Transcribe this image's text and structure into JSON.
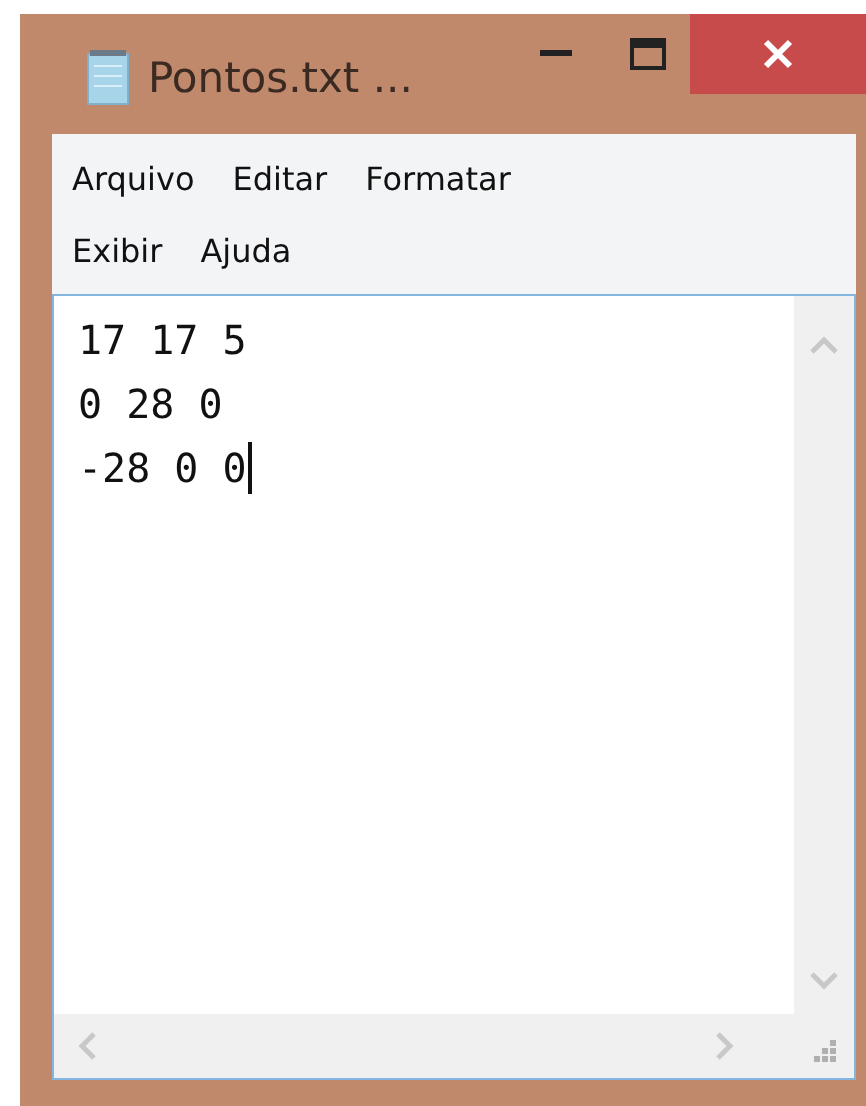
{
  "window": {
    "title": "Pontos.txt ..."
  },
  "menu_rows": [
    [
      "Arquivo",
      "Editar",
      "Formatar"
    ],
    [
      "Exibir",
      "Ajuda"
    ]
  ],
  "editor": {
    "lines": [
      "17 17 5",
      "0 28 0",
      "-28 0 0"
    ]
  }
}
